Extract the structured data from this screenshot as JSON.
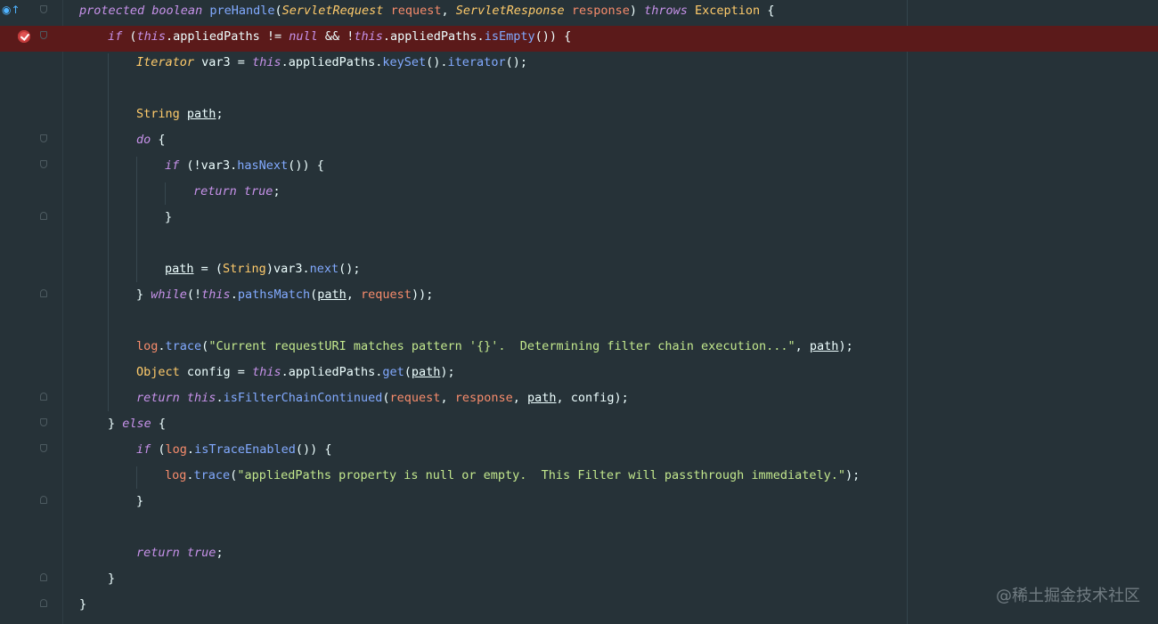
{
  "lines": [
    {
      "tokens": [
        [
          "kw",
          "protected"
        ],
        [
          "pl",
          " "
        ],
        [
          "kw",
          "boolean"
        ],
        [
          "pl",
          " "
        ],
        [
          "fn",
          "preHandle"
        ],
        [
          "pl",
          "("
        ],
        [
          "tyi",
          "ServletRequest"
        ],
        [
          "pl",
          " "
        ],
        [
          "pm",
          "request"
        ],
        [
          "pl",
          ", "
        ],
        [
          "tyi",
          "ServletResponse"
        ],
        [
          "pl",
          " "
        ],
        [
          "pm",
          "response"
        ],
        [
          "pl",
          ") "
        ],
        [
          "kw",
          "throws"
        ],
        [
          "pl",
          " "
        ],
        [
          "ty",
          "Exception"
        ],
        [
          "pl",
          " {"
        ]
      ]
    },
    {
      "tokens": [
        [
          "kw",
          "if"
        ],
        [
          "pl",
          " ("
        ],
        [
          "kw",
          "this"
        ],
        [
          "pl",
          ".appliedPaths != "
        ],
        [
          "kw",
          "null"
        ],
        [
          "pl",
          " && !"
        ],
        [
          "kw",
          "this"
        ],
        [
          "pl",
          ".appliedPaths."
        ],
        [
          "fn",
          "isEmpty"
        ],
        [
          "pl",
          "()) {"
        ]
      ]
    },
    {
      "tokens": [
        [
          "tyi",
          "Iterator"
        ],
        [
          "pl",
          " var3 = "
        ],
        [
          "kw",
          "this"
        ],
        [
          "pl",
          ".appliedPaths."
        ],
        [
          "fn",
          "keySet"
        ],
        [
          "pl",
          "()."
        ],
        [
          "fn",
          "iterator"
        ],
        [
          "pl",
          "();"
        ]
      ]
    },
    {
      "tokens": []
    },
    {
      "tokens": [
        [
          "ty",
          "String"
        ],
        [
          "pl",
          " "
        ],
        [
          "ul",
          "path"
        ],
        [
          "pl",
          ";"
        ]
      ]
    },
    {
      "tokens": [
        [
          "kw",
          "do"
        ],
        [
          "pl",
          " {"
        ]
      ]
    },
    {
      "tokens": [
        [
          "kw",
          "if"
        ],
        [
          "pl",
          " (!var3."
        ],
        [
          "fn",
          "hasNext"
        ],
        [
          "pl",
          "()) {"
        ]
      ]
    },
    {
      "tokens": [
        [
          "kw",
          "return"
        ],
        [
          "pl",
          " "
        ],
        [
          "kw",
          "true"
        ],
        [
          "pl",
          ";"
        ]
      ]
    },
    {
      "tokens": [
        [
          "pl",
          "}"
        ]
      ]
    },
    {
      "tokens": []
    },
    {
      "tokens": [
        [
          "ul",
          "path"
        ],
        [
          "pl",
          " = ("
        ],
        [
          "ty",
          "String"
        ],
        [
          "pl",
          ")var3."
        ],
        [
          "fn",
          "next"
        ],
        [
          "pl",
          "();"
        ]
      ]
    },
    {
      "tokens": [
        [
          "pl",
          "} "
        ],
        [
          "kw",
          "while"
        ],
        [
          "pl",
          "(!"
        ],
        [
          "kw",
          "this"
        ],
        [
          "pl",
          "."
        ],
        [
          "fn",
          "pathsMatch"
        ],
        [
          "pl",
          "("
        ],
        [
          "ul",
          "path"
        ],
        [
          "pl",
          ", "
        ],
        [
          "pm",
          "request"
        ],
        [
          "pl",
          "));"
        ]
      ]
    },
    {
      "tokens": []
    },
    {
      "tokens": [
        [
          "pm",
          "log"
        ],
        [
          "pl",
          "."
        ],
        [
          "fn",
          "trace"
        ],
        [
          "pl",
          "("
        ],
        [
          "st",
          "\"Current requestURI matches pattern '{}'.  Determining filter chain execution...\""
        ],
        [
          "pl",
          ", "
        ],
        [
          "ul",
          "path"
        ],
        [
          "pl",
          ");"
        ]
      ]
    },
    {
      "tokens": [
        [
          "ty",
          "Object"
        ],
        [
          "pl",
          " config = "
        ],
        [
          "kw",
          "this"
        ],
        [
          "pl",
          ".appliedPaths."
        ],
        [
          "fn",
          "get"
        ],
        [
          "pl",
          "("
        ],
        [
          "ul",
          "path"
        ],
        [
          "pl",
          ");"
        ]
      ]
    },
    {
      "tokens": [
        [
          "kw",
          "return"
        ],
        [
          "pl",
          " "
        ],
        [
          "kw",
          "this"
        ],
        [
          "pl",
          "."
        ],
        [
          "fn",
          "isFilterChainContinued"
        ],
        [
          "pl",
          "("
        ],
        [
          "pm",
          "request"
        ],
        [
          "pl",
          ", "
        ],
        [
          "pm",
          "response"
        ],
        [
          "pl",
          ", "
        ],
        [
          "ul",
          "path"
        ],
        [
          "pl",
          ", config);"
        ]
      ]
    },
    {
      "tokens": [
        [
          "pl",
          "} "
        ],
        [
          "kw",
          "else"
        ],
        [
          "pl",
          " {"
        ]
      ]
    },
    {
      "tokens": [
        [
          "kw",
          "if"
        ],
        [
          "pl",
          " ("
        ],
        [
          "pm",
          "log"
        ],
        [
          "pl",
          "."
        ],
        [
          "fn",
          "isTraceEnabled"
        ],
        [
          "pl",
          "()) {"
        ]
      ]
    },
    {
      "tokens": [
        [
          "pm",
          "log"
        ],
        [
          "pl",
          "."
        ],
        [
          "fn",
          "trace"
        ],
        [
          "pl",
          "("
        ],
        [
          "st",
          "\"appliedPaths property is null or empty.  This Filter will passthrough immediately.\""
        ],
        [
          "pl",
          ");"
        ]
      ]
    },
    {
      "tokens": [
        [
          "pl",
          "}"
        ]
      ]
    },
    {
      "tokens": []
    },
    {
      "tokens": [
        [
          "kw",
          "return"
        ],
        [
          "pl",
          " "
        ],
        [
          "kw",
          "true"
        ],
        [
          "pl",
          ";"
        ]
      ]
    },
    {
      "tokens": [
        [
          "pl",
          "}"
        ]
      ]
    },
    {
      "tokens": [
        [
          "pl",
          "}"
        ]
      ]
    }
  ],
  "gutter_icons": {
    "override": "override-icon",
    "breakpoint": "breakpoint-icon"
  },
  "colors": {
    "background": "#263238",
    "breakpoint_line": "#5b1a1a",
    "keyword": "#c792ea",
    "type": "#ffcb6b",
    "function": "#82aaff",
    "parameter": "#f78c6c",
    "string": "#c3e88d"
  },
  "watermark": "@稀土掘金技术社区"
}
